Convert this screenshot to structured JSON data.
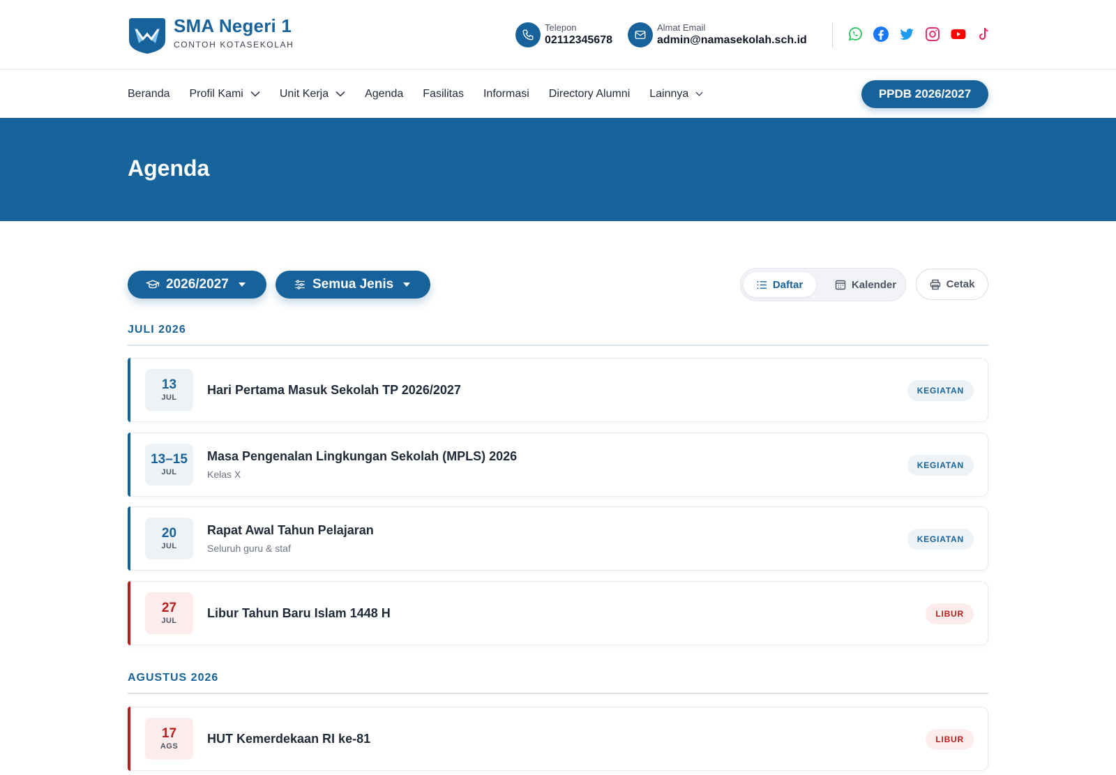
{
  "brand": {
    "name": "SMA Negeri 1",
    "subtitle": "CONTOH KOTASEKOLAH"
  },
  "contact": {
    "phone_label": "Telepon",
    "phone_value": "02112345678",
    "email_label": "Almat Email",
    "email_value": "admin@namasekolah.sch.id"
  },
  "socials": [
    "whatsapp-icon",
    "facebook-icon",
    "twitter-icon",
    "instagram-icon",
    "youtube-icon",
    "tiktok-icon"
  ],
  "nav": {
    "items": [
      {
        "label": "Beranda"
      },
      {
        "label": "Profil Kami"
      },
      {
        "label": "Unit Kerja"
      },
      {
        "label": "Agenda"
      },
      {
        "label": "Fasilitas"
      },
      {
        "label": "Informasi"
      },
      {
        "label": "Directory Alumni"
      },
      {
        "label": "Lainnya"
      }
    ],
    "cta": "PPDB 2026/2027"
  },
  "hero": {
    "title": "Agenda"
  },
  "filters": {
    "year": "2026/2027",
    "type": "Semua Jenis"
  },
  "view": {
    "list": "Daftar",
    "calendar": "Kalender",
    "print": "Cetak"
  },
  "months": [
    {
      "label": "JULI 2026",
      "events": [
        {
          "day": "13",
          "month": "JUL",
          "title": "Hari Pertama Masuk Sekolah TP 2026/2027",
          "subtitle": "",
          "badge": "KEGIATAN"
        },
        {
          "day": "13–15",
          "month": "JUL",
          "title": "Masa Pengenalan Lingkungan Sekolah (MPLS) 2026",
          "subtitle": "Kelas X",
          "badge": "KEGIATAN"
        },
        {
          "day": "20",
          "month": "JUL",
          "title": "Rapat Awal Tahun Pelajaran",
          "subtitle": "Seluruh guru & staf",
          "badge": "KEGIATAN"
        },
        {
          "day": "27",
          "month": "JUL",
          "title": "Libur Tahun Baru Islam 1448 H",
          "subtitle": "",
          "badge": "LIBUR"
        }
      ]
    },
    {
      "label": "AGUSTUS 2026",
      "events": [
        {
          "day": "17",
          "month": "AGS",
          "title": "HUT Kemerdekaan RI ke-81",
          "subtitle": "",
          "badge": "LIBUR"
        }
      ]
    }
  ],
  "colors": {
    "primary": "#17629b",
    "hero": "#17639c",
    "holiday": "#b91c1c"
  }
}
